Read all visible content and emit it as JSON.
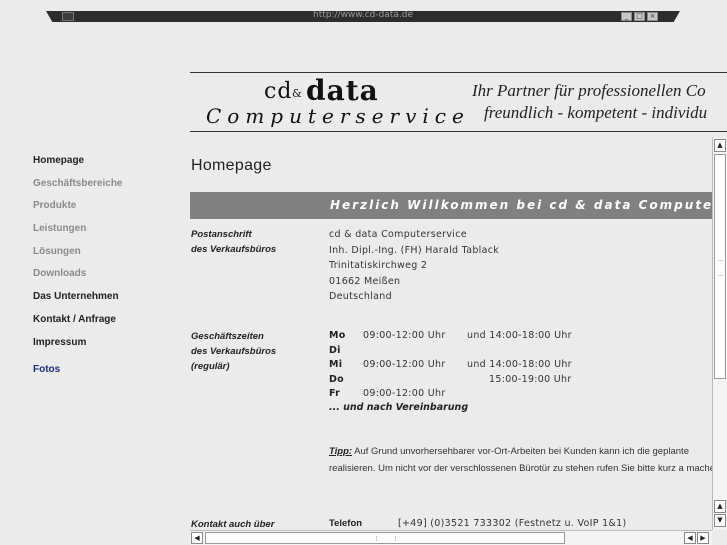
{
  "window": {
    "title": "http://www.cd-data.de",
    "buttons": {
      "minimize": "_",
      "maximize": "□",
      "close": "×"
    }
  },
  "header": {
    "logo_cd": "cd",
    "logo_amp": "&",
    "logo_data": "data",
    "logo_sub": "Computerservice",
    "slogan_line1": "Ihr Partner für professionellen Co",
    "slogan_line2": "freundlich - kompetent - individu"
  },
  "nav": {
    "items": [
      {
        "label": "Homepage"
      },
      {
        "label": "Geschäftsbereiche"
      },
      {
        "label": "Produkte"
      },
      {
        "label": "Leistungen"
      },
      {
        "label": "Lösungen"
      },
      {
        "label": "Downloads"
      },
      {
        "label": "Das Unternehmen"
      },
      {
        "label": "Kontakt / Anfrage"
      },
      {
        "label": "Impressum"
      },
      {
        "label": "Fotos"
      }
    ]
  },
  "main": {
    "page_title": "Homepage",
    "banner": "Herzlich Willkommen bei cd & data Computerserv",
    "postanschrift": {
      "label_line1": "Postanschrift",
      "label_line2": "des Verkaufsbüros",
      "lines": [
        "cd & data Computerservice",
        "Inh. Dipl.-Ing. (FH) Harald Tablack",
        "Trinitatiskirchweg 2",
        "01662 Meißen",
        "Deutschland"
      ]
    },
    "geschaeftszeiten": {
      "label_line1": "Geschäftszeiten",
      "label_line2": "des Verkaufsbüros",
      "label_line3": "(regulär)",
      "rows": [
        {
          "day": "Mo",
          "t1": "09:00-12:00 Uhr",
          "t2": "und 14:00-18:00 Uhr"
        },
        {
          "day": "Di",
          "t1": "",
          "t2": ""
        },
        {
          "day": "Mi",
          "t1": "09:00-12:00 Uhr",
          "t2": "und 14:00-18:00 Uhr"
        },
        {
          "day": "Do",
          "t1": "",
          "t2": "15:00-19:00 Uhr"
        },
        {
          "day": "Fr",
          "t1": "09:00-12:00 Uhr",
          "t2": ""
        }
      ],
      "footnote": "... und nach Vereinbarung"
    },
    "tipp": {
      "label": "Tipp:",
      "text": " Auf Grund unvorhersehbarer vor-Ort-Arbeiten bei Kunden kann ich die geplante realisieren. Um nicht vor der verschlossenen Bürotür zu stehen rufen Sie bitte kurz a machen."
    },
    "kontakt": {
      "label": "Kontakt auch über",
      "telefon_label": "Telefon",
      "telefon_value": "[+49] (0)3521 733302 (Festnetz u. VoIP 1&1)"
    }
  },
  "scrollbars": {
    "up": "▲",
    "down": "▼",
    "left": "◀",
    "right": "▶"
  }
}
